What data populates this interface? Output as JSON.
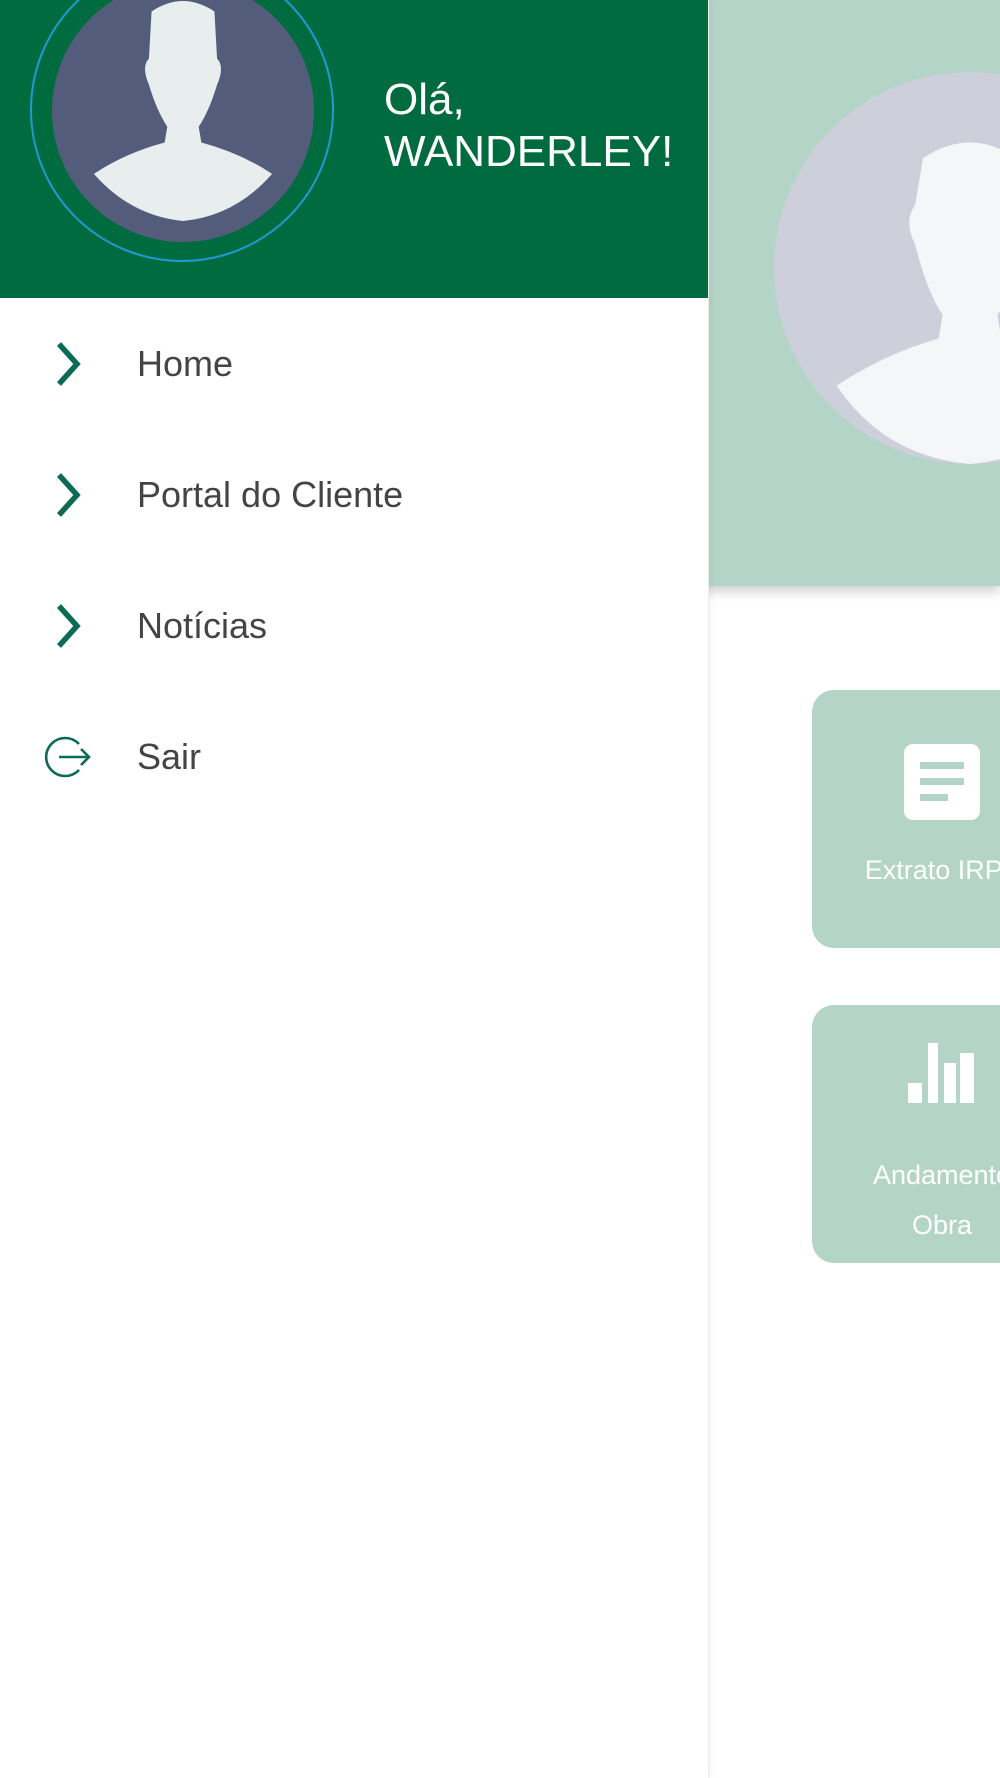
{
  "drawer": {
    "greeting_line1": "Olá,",
    "greeting_line2": "WANDERLEY!",
    "menu": [
      {
        "label": "Home",
        "icon": "chevron-right-icon"
      },
      {
        "label": "Portal do Cliente",
        "icon": "chevron-right-icon"
      },
      {
        "label": "Notícias",
        "icon": "chevron-right-icon"
      },
      {
        "label": "Sair",
        "icon": "logout-icon"
      }
    ]
  },
  "background": {
    "tiles": [
      {
        "label": "Extrato IRPF",
        "icon": "document-icon"
      },
      {
        "label_line1": "Andamento",
        "label_line2": "Obra",
        "icon": "bar-chart-icon"
      }
    ]
  },
  "colors": {
    "drawer_header": "#006b3f",
    "accent": "#0b6b57",
    "tile_background": "#b4d4c7",
    "avatar_background": "#535d7b",
    "avatar_ring": "#1e9ad6"
  }
}
